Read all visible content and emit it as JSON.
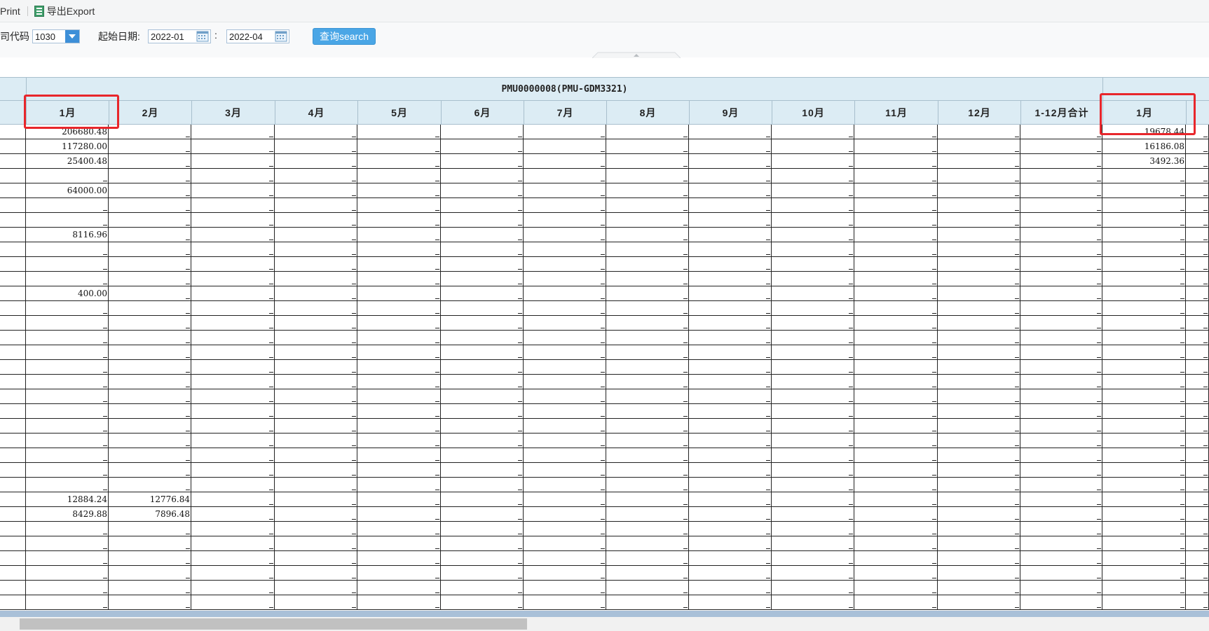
{
  "toolbar": {
    "print_label": "Print",
    "export_label": "导出Export",
    "export_icon": "excel-icon"
  },
  "filters": {
    "company_code_label": "司代码",
    "company_code_value": "1030",
    "start_date_label": "起始日期:",
    "start_date_value": "2022-01",
    "range_separator": ":",
    "end_date_value": "2022-04",
    "search_label": "查询search"
  },
  "table": {
    "group_header": "PMU0000008(PMU-GDM3321)",
    "month_headers": [
      "1月",
      "2月",
      "3月",
      "4月",
      "5月",
      "6月",
      "7月",
      "8月",
      "9月",
      "10月",
      "11月",
      "12月",
      "1-12月合计",
      "1月"
    ],
    "rows": [
      [
        "206680.48",
        "",
        "",
        "",
        "",
        "",
        "",
        "",
        "",
        "",
        "",
        "",
        "",
        "19678.44"
      ],
      [
        "117280.00",
        "",
        "",
        "",
        "",
        "",
        "",
        "",
        "",
        "",
        "",
        "",
        "",
        "16186.08"
      ],
      [
        "25400.48",
        "",
        "",
        "",
        "",
        "",
        "",
        "",
        "",
        "",
        "",
        "",
        "",
        "3492.36"
      ],
      [
        "",
        "",
        "",
        "",
        "",
        "",
        "",
        "",
        "",
        "",
        "",
        "",
        "",
        ""
      ],
      [
        "64000.00",
        "",
        "",
        "",
        "",
        "",
        "",
        "",
        "",
        "",
        "",
        "",
        "",
        ""
      ],
      [
        "",
        "",
        "",
        "",
        "",
        "",
        "",
        "",
        "",
        "",
        "",
        "",
        "",
        ""
      ],
      [
        "",
        "",
        "",
        "",
        "",
        "",
        "",
        "",
        "",
        "",
        "",
        "",
        "",
        ""
      ],
      [
        "8116.96",
        "",
        "",
        "",
        "",
        "",
        "",
        "",
        "",
        "",
        "",
        "",
        "",
        ""
      ],
      [
        "",
        "",
        "",
        "",
        "",
        "",
        "",
        "",
        "",
        "",
        "",
        "",
        "",
        ""
      ],
      [
        "",
        "",
        "",
        "",
        "",
        "",
        "",
        "",
        "",
        "",
        "",
        "",
        "",
        ""
      ],
      [
        "",
        "",
        "",
        "",
        "",
        "",
        "",
        "",
        "",
        "",
        "",
        "",
        "",
        ""
      ],
      [
        "400.00",
        "",
        "",
        "",
        "",
        "",
        "",
        "",
        "",
        "",
        "",
        "",
        "",
        ""
      ],
      [
        "",
        "",
        "",
        "",
        "",
        "",
        "",
        "",
        "",
        "",
        "",
        "",
        "",
        ""
      ],
      [
        "",
        "",
        "",
        "",
        "",
        "",
        "",
        "",
        "",
        "",
        "",
        "",
        "",
        ""
      ],
      [
        "",
        "",
        "",
        "",
        "",
        "",
        "",
        "",
        "",
        "",
        "",
        "",
        "",
        ""
      ],
      [
        "",
        "",
        "",
        "",
        "",
        "",
        "",
        "",
        "",
        "",
        "",
        "",
        "",
        ""
      ],
      [
        "",
        "",
        "",
        "",
        "",
        "",
        "",
        "",
        "",
        "",
        "",
        "",
        "",
        ""
      ],
      [
        "",
        "",
        "",
        "",
        "",
        "",
        "",
        "",
        "",
        "",
        "",
        "",
        "",
        ""
      ],
      [
        "",
        "",
        "",
        "",
        "",
        "",
        "",
        "",
        "",
        "",
        "",
        "",
        "",
        ""
      ],
      [
        "",
        "",
        "",
        "",
        "",
        "",
        "",
        "",
        "",
        "",
        "",
        "",
        "",
        ""
      ],
      [
        "",
        "",
        "",
        "",
        "",
        "",
        "",
        "",
        "",
        "",
        "",
        "",
        "",
        ""
      ],
      [
        "",
        "",
        "",
        "",
        "",
        "",
        "",
        "",
        "",
        "",
        "",
        "",
        "",
        ""
      ],
      [
        "",
        "",
        "",
        "",
        "",
        "",
        "",
        "",
        "",
        "",
        "",
        "",
        "",
        ""
      ],
      [
        "",
        "",
        "",
        "",
        "",
        "",
        "",
        "",
        "",
        "",
        "",
        "",
        "",
        ""
      ],
      [
        "",
        "",
        "",
        "",
        "",
        "",
        "",
        "",
        "",
        "",
        "",
        "",
        "",
        ""
      ],
      [
        "12884.24",
        "12776.84",
        "",
        "",
        "",
        "",
        "",
        "",
        "",
        "",
        "",
        "",
        "",
        ""
      ],
      [
        "8429.88",
        "7896.48",
        "",
        "",
        "",
        "",
        "",
        "",
        "",
        "",
        "",
        "",
        "",
        ""
      ],
      [
        "",
        "",
        "",
        "",
        "",
        "",
        "",
        "",
        "",
        "",
        "",
        "",
        "",
        ""
      ],
      [
        "",
        "",
        "",
        "",
        "",
        "",
        "",
        "",
        "",
        "",
        "",
        "",
        "",
        ""
      ],
      [
        "",
        "",
        "",
        "",
        "",
        "",
        "",
        "",
        "",
        "",
        "",
        "",
        "",
        ""
      ],
      [
        "",
        "",
        "",
        "",
        "",
        "",
        "",
        "",
        "",
        "",
        "",
        "",
        "",
        ""
      ],
      [
        "",
        "",
        "",
        "",
        "",
        "",
        "",
        "",
        "",
        "",
        "",
        "",
        "",
        ""
      ],
      [
        "",
        "",
        "",
        "",
        "",
        "",
        "",
        "",
        "",
        "",
        "",
        "",
        "",
        ""
      ]
    ]
  },
  "colors": {
    "header_bg": "#dcecf4",
    "accent": "#4aa6e6",
    "highlight": "#e8262b"
  }
}
